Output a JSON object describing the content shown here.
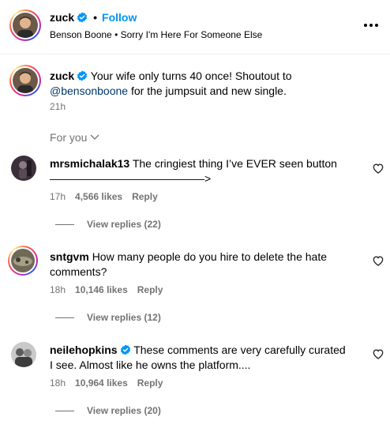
{
  "header": {
    "username": "zuck",
    "separator": "•",
    "follow_label": "Follow",
    "audio_label": "Benson Boone • Sorry I'm Here For Someone Else"
  },
  "caption": {
    "username": "zuck",
    "text_before": "Your wife only turns 40 once! Shoutout to",
    "mention": "@bensonboone",
    "text_after": " for the jumpsuit and new single.",
    "time": "21h"
  },
  "sort": {
    "label": "For you"
  },
  "comments": [
    {
      "username": "mrsmichalak13",
      "text": "The cringiest thing I’ve EVER seen button",
      "line2": "——————————————>",
      "time": "17h",
      "likes": "4,566 likes",
      "reply_label": "Reply",
      "view_replies": "View replies (22)"
    },
    {
      "username": "sntgvm",
      "text": "How many people do you hire to delete the hate comments?",
      "time": "18h",
      "likes": "10,146 likes",
      "reply_label": "Reply",
      "view_replies": "View replies (12)"
    },
    {
      "username": "neilehopkins",
      "text": "These comments are very carefully curated I see. Almost like he owns the platform....",
      "time": "18h",
      "likes": "10,964 likes",
      "reply_label": "Reply",
      "view_replies": "View replies (20)"
    }
  ],
  "icons": {
    "verified": "verified-badge-icon",
    "more": "more-options-icon",
    "chevron": "chevron-down-icon",
    "like": "heart-icon"
  },
  "colors": {
    "accent": "#0095f6",
    "muted": "#737373",
    "mention": "#00376b"
  }
}
